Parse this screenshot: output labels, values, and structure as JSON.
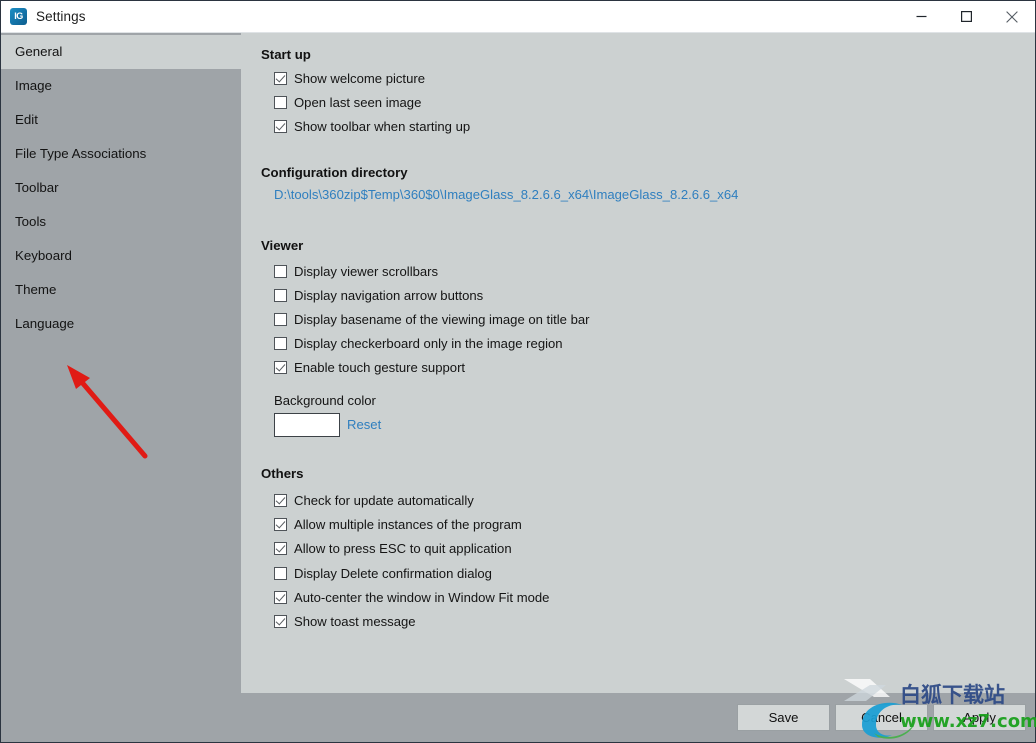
{
  "window": {
    "title": "Settings",
    "app_icon": "imageglass-icon",
    "icon_glyph": "IG",
    "controls": {
      "minimize": "minimize-icon",
      "maximize": "maximize-icon",
      "close": "close-icon"
    }
  },
  "sidebar": {
    "items": [
      {
        "label": "General",
        "selected": true
      },
      {
        "label": "Image",
        "selected": false
      },
      {
        "label": "Edit",
        "selected": false
      },
      {
        "label": "File Type Associations",
        "selected": false
      },
      {
        "label": "Toolbar",
        "selected": false
      },
      {
        "label": "Tools",
        "selected": false
      },
      {
        "label": "Keyboard",
        "selected": false
      },
      {
        "label": "Theme",
        "selected": false
      },
      {
        "label": "Language",
        "selected": false
      }
    ]
  },
  "content": {
    "startup": {
      "title": "Start up",
      "options": [
        {
          "label": "Show welcome picture",
          "checked": true
        },
        {
          "label": "Open last seen image",
          "checked": false
        },
        {
          "label": "Show toolbar when starting up",
          "checked": true
        }
      ]
    },
    "config_directory": {
      "title": "Configuration directory",
      "path": "D:\\tools\\360zip$Temp\\360$0\\ImageGlass_8.2.6.6_x64\\ImageGlass_8.2.6.6_x64"
    },
    "viewer": {
      "title": "Viewer",
      "options": [
        {
          "label": "Display viewer scrollbars",
          "checked": false
        },
        {
          "label": "Display navigation arrow buttons",
          "checked": false
        },
        {
          "label": "Display basename of the viewing image on title bar",
          "checked": false
        },
        {
          "label": "Display checkerboard only in the image region",
          "checked": false
        },
        {
          "label": "Enable touch gesture support",
          "checked": true
        }
      ],
      "background_color_label": "Background color",
      "background_color_value": "#ffffff",
      "reset_label": "Reset"
    },
    "others": {
      "title": "Others",
      "options": [
        {
          "label": "Check for update automatically",
          "checked": true
        },
        {
          "label": "Allow multiple instances of the program",
          "checked": true
        },
        {
          "label": "Allow to press ESC to quit application",
          "checked": true
        },
        {
          "label": "Display Delete confirmation dialog",
          "checked": false
        },
        {
          "label": "Auto-center the window in Window Fit mode",
          "checked": true
        },
        {
          "label": "Show toast message",
          "checked": true
        }
      ]
    }
  },
  "footer": {
    "save_label": "Save",
    "cancel_label": "Cancel",
    "apply_label": "Apply"
  },
  "annotation": {
    "arrow": "red-arrow-pointing-to-language",
    "arrow_color": "#e01b15"
  },
  "watermark": {
    "site_text": "www.xz7.com",
    "cn_text": "白狐下载站",
    "site_color": "#17a01a"
  },
  "colors": {
    "sidebar_bg": "#9fa4a8",
    "content_bg": "#ccd1d1",
    "titlebar_bg": "#ffffff",
    "link": "#2f7fbf",
    "button_bg": "#d3d7d7"
  }
}
